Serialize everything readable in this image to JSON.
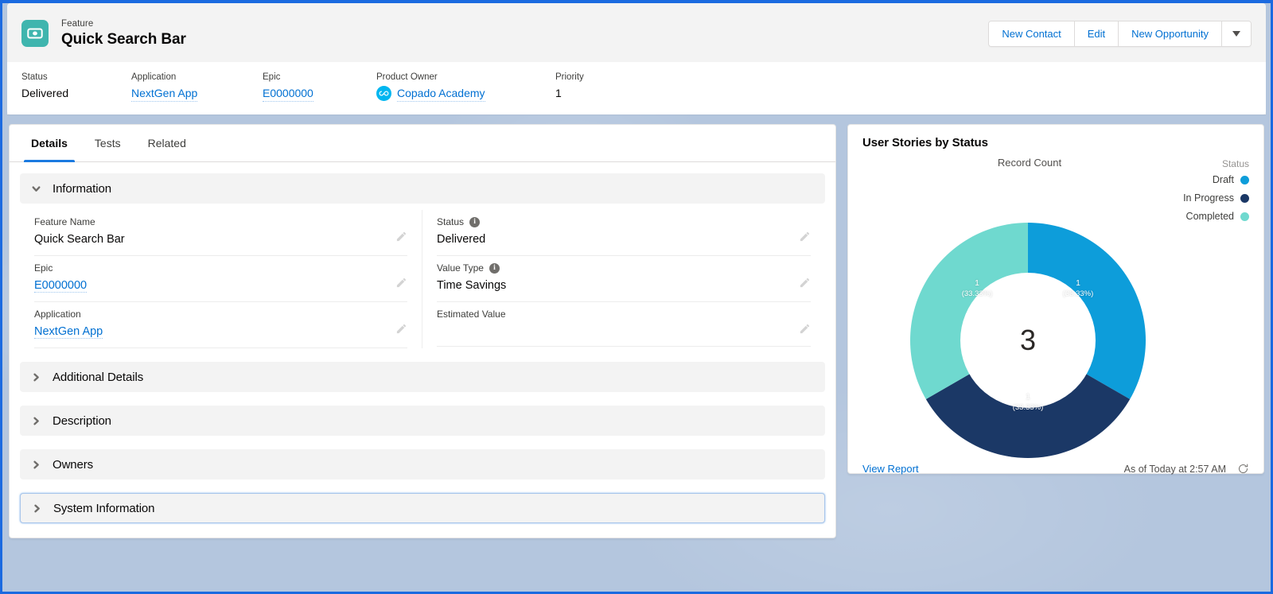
{
  "header": {
    "entity_type": "Feature",
    "record_name": "Quick Search Bar",
    "icon": "banknote-icon",
    "actions": [
      {
        "label": "New Contact",
        "name": "new-contact-button"
      },
      {
        "label": "Edit",
        "name": "edit-button"
      },
      {
        "label": "New Opportunity",
        "name": "new-opportunity-button"
      }
    ],
    "more_actions_icon": "chevron-down-icon",
    "highlights": [
      {
        "label": "Status",
        "value": "Delivered",
        "link": false
      },
      {
        "label": "Application",
        "value": "NextGen App",
        "link": true
      },
      {
        "label": "Epic",
        "value": "E0000000",
        "link": true
      },
      {
        "label": "Product Owner",
        "value": "Copado Academy",
        "link": true,
        "avatar": "copado-logo-icon"
      },
      {
        "label": "Priority",
        "value": "1",
        "link": false
      }
    ]
  },
  "tabs": [
    {
      "label": "Details",
      "active": true
    },
    {
      "label": "Tests",
      "active": false
    },
    {
      "label": "Related",
      "active": false
    }
  ],
  "sections": {
    "information": {
      "label": "Information",
      "expanded": true
    },
    "additional_details": {
      "label": "Additional Details",
      "expanded": false
    },
    "description": {
      "label": "Description",
      "expanded": false
    },
    "owners": {
      "label": "Owners",
      "expanded": false
    },
    "system_information": {
      "label": "System Information",
      "expanded": false,
      "focused": true
    }
  },
  "fields": {
    "left": [
      {
        "label": "Feature Name",
        "value": "Quick Search Bar",
        "link": false,
        "info": false
      },
      {
        "label": "Epic",
        "value": "E0000000",
        "link": true,
        "info": false
      },
      {
        "label": "Application",
        "value": "NextGen App",
        "link": true,
        "info": false
      }
    ],
    "right": [
      {
        "label": "Status",
        "value": "Delivered",
        "link": false,
        "info": true
      },
      {
        "label": "Value Type",
        "value": "Time Savings",
        "link": false,
        "info": true
      },
      {
        "label": "Estimated Value",
        "value": "",
        "link": false,
        "info": false
      }
    ]
  },
  "chart_card": {
    "title": "User Stories by Status",
    "view_report_label": "View Report",
    "as_of_label": "As of Today at 2:57 AM",
    "refresh_icon": "refresh-icon"
  },
  "chart_data": {
    "type": "pie",
    "title": "User Stories by Status",
    "subtitle": "Record Count",
    "measure_label": "Record Count",
    "legend_title": "Status",
    "legend_position": "right",
    "donut": true,
    "center_total": "3",
    "total": 3,
    "categories": [
      "Draft",
      "In Progress",
      "Completed"
    ],
    "values": [
      1,
      1,
      1
    ],
    "percentages": [
      "33.33%",
      "33.33%",
      "33.33%"
    ],
    "slice_labels": [
      "1",
      "1",
      "1"
    ],
    "slice_pct_labels": [
      "(33.33%)",
      "(33.33%)",
      "(33.33%)"
    ],
    "colors": [
      "#0d9dda",
      "#1b3866",
      "#6fd9cf"
    ]
  },
  "theme": {
    "link": "#0070d2",
    "accent": "#1b7ae0",
    "icon_bg": "#3fb5ae",
    "page_bg": "#b4c6de",
    "frame": "#1b6ae0"
  }
}
